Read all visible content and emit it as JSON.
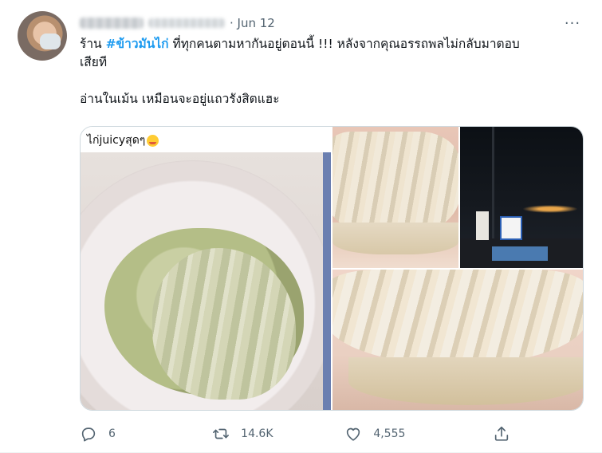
{
  "tweet": {
    "date": "Jun 12",
    "more_label": "···",
    "line1_prefix": "ร้าน ",
    "hashtag": "#ข้าวมันไก่",
    "line1_suffix": " ที่ทุกคนตามหากันอยู่ตอนนี้ !!! หลังจากคุณอรรถพลไม่กลับมาตอบ",
    "line2": "เสียที",
    "line3": "อ่านในเม้น เหมือนจะอยู่แถวรังสิตแฮะ",
    "photo_caption": "ไก่juicyสุดๆ"
  },
  "actions": {
    "replies": "6",
    "retweets": "14.6K",
    "likes": "4,555"
  },
  "icons": {
    "reply": "reply-icon",
    "retweet": "retweet-icon",
    "like": "heart-icon",
    "share": "share-icon",
    "emoji": "grinning-face-emoji"
  },
  "colors": {
    "accent": "#1d9bf0",
    "secondary_text": "#536471",
    "text": "#0f1419"
  }
}
